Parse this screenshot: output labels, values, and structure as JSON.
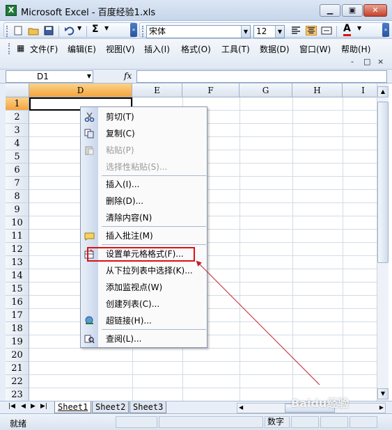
{
  "window": {
    "title": "Microsoft Excel - 百度经验1.xls",
    "app_icon": "excel-icon",
    "buttons": [
      "minimize",
      "maximize",
      "close"
    ]
  },
  "toolbar": {
    "font_name": "宋体",
    "font_size": "12",
    "sum_label": "Σ",
    "font_color_label": "A"
  },
  "menubar": {
    "items": [
      "文件(F)",
      "编辑(E)",
      "视图(V)",
      "插入(I)",
      "格式(O)",
      "工具(T)",
      "数据(D)",
      "窗口(W)",
      "帮助(H)"
    ],
    "window_controls": [
      "-",
      "□",
      "×"
    ]
  },
  "formula_bar": {
    "name_box": "D1",
    "fx_label": "fx",
    "formula": ""
  },
  "grid": {
    "columns": [
      "D",
      "E",
      "F",
      "G",
      "H",
      "I"
    ],
    "active_column": "D",
    "rows": [
      "1",
      "2",
      "3",
      "4",
      "5",
      "6",
      "7",
      "8",
      "9",
      "10",
      "11",
      "12",
      "13",
      "14",
      "15",
      "16",
      "17",
      "18",
      "19",
      "20",
      "21",
      "22",
      "23"
    ],
    "active_row": "1"
  },
  "context_menu": {
    "items": [
      {
        "label": "剪切(T)",
        "icon": "scissors-icon",
        "disabled": false
      },
      {
        "label": "复制(C)",
        "icon": "copy-icon",
        "disabled": false
      },
      {
        "label": "粘贴(P)",
        "icon": "paste-icon",
        "disabled": true
      },
      {
        "label": "选择性粘贴(S)...",
        "icon": "",
        "disabled": true
      },
      {
        "label": "插入(I)...",
        "icon": "",
        "disabled": false
      },
      {
        "label": "删除(D)...",
        "icon": "",
        "disabled": false
      },
      {
        "label": "清除内容(N)",
        "icon": "",
        "disabled": false
      },
      {
        "label": "插入批注(M)",
        "icon": "comment-icon",
        "disabled": false
      },
      {
        "label": "设置单元格格式(F)...",
        "icon": "format-cells-icon",
        "disabled": false
      },
      {
        "label": "从下拉列表中选择(K)...",
        "icon": "",
        "disabled": false
      },
      {
        "label": "添加监视点(W)",
        "icon": "",
        "disabled": false
      },
      {
        "label": "创建列表(C)...",
        "icon": "",
        "disabled": false
      },
      {
        "label": "超链接(H)...",
        "icon": "hyperlink-icon",
        "disabled": false
      },
      {
        "label": "查阅(L)...",
        "icon": "research-icon",
        "disabled": false
      }
    ],
    "highlighted": "设置单元格格式(F)..."
  },
  "sheet_tabs": {
    "nav": [
      "|◀",
      "◀",
      "▶",
      "▶|"
    ],
    "tabs": [
      "Sheet1",
      "Sheet2",
      "Sheet3"
    ],
    "active": "Sheet1"
  },
  "status_bar": {
    "ready": "就绪",
    "num": "数字"
  },
  "watermark": "Baidu经验",
  "colors": {
    "active_header": "#f3a43f",
    "highlight_border": "#dd1111",
    "arrow": "#c0202a"
  }
}
